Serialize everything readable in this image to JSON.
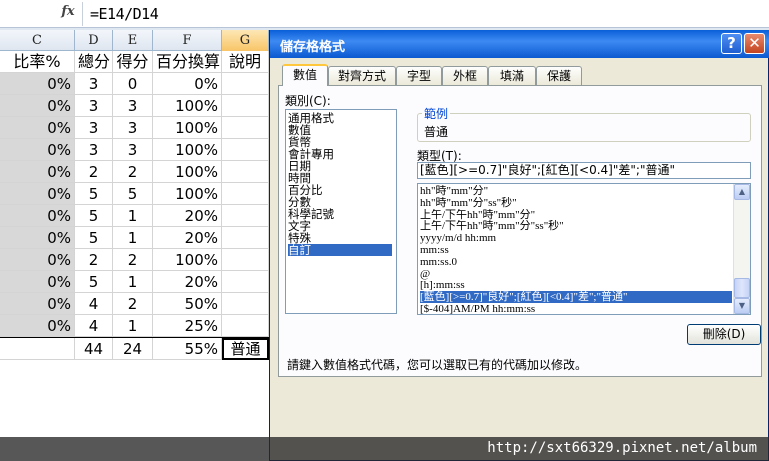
{
  "formula_bar": {
    "fx_label": "fx",
    "formula": "=E14/D14"
  },
  "sheet": {
    "columns": [
      "C",
      "D",
      "E",
      "F",
      "G"
    ],
    "selected_column": "G",
    "header_row": [
      "比率%",
      "總分",
      "得分",
      "百分換算",
      "說明"
    ],
    "rows": [
      [
        "0%",
        "3",
        "0",
        "0%"
      ],
      [
        "0%",
        "3",
        "3",
        "100%"
      ],
      [
        "0%",
        "3",
        "3",
        "100%"
      ],
      [
        "0%",
        "3",
        "3",
        "100%"
      ],
      [
        "0%",
        "2",
        "2",
        "100%"
      ],
      [
        "0%",
        "5",
        "5",
        "100%"
      ],
      [
        "0%",
        "5",
        "1",
        "20%"
      ],
      [
        "0%",
        "5",
        "1",
        "20%"
      ],
      [
        "0%",
        "2",
        "2",
        "100%"
      ],
      [
        "0%",
        "5",
        "1",
        "20%"
      ],
      [
        "0%",
        "4",
        "2",
        "50%"
      ],
      [
        "0%",
        "4",
        "1",
        "25%"
      ]
    ],
    "total_row": [
      "",
      "44",
      "24",
      "55%",
      "普通"
    ]
  },
  "dialog": {
    "title": "儲存格格式",
    "help_label": "?",
    "close_label": "✕",
    "tabs": [
      "數值",
      "對齊方式",
      "字型",
      "外框",
      "填滿",
      "保護"
    ],
    "active_tab": "數值",
    "category_label": "類別(C):",
    "categories": [
      "通用格式",
      "數值",
      "貨幣",
      "會計專用",
      "日期",
      "時間",
      "百分比",
      "分數",
      "科學記號",
      "文字",
      "特殊",
      "自訂"
    ],
    "selected_category": "自訂",
    "sample_label": "範例",
    "sample_value": "普通",
    "type_label": "類型(T):",
    "type_value": "[藍色][>=0.7]\"良好\";[紅色][<0.4]\"差\";\"普通\"",
    "type_list": [
      "hh\"時\"mm\"分\"",
      "hh\"時\"mm\"分\"ss\"秒\"",
      "上午/下午hh\"時\"mm\"分\"",
      "上午/下午hh\"時\"mm\"分\"ss\"秒\"",
      "yyyy/m/d hh:mm",
      "mm:ss",
      "mm:ss.0",
      "@",
      "[h]:mm:ss",
      "[藍色][>=0.7]\"良好\";[紅色][<0.4]\"差\";\"普通\"",
      "[$-404]AM/PM hh:mm:ss"
    ],
    "selected_type": "[藍色][>=0.7]\"良好\";[紅色][<0.4]\"差\";\"普通\"",
    "delete_label": "刪除(D)",
    "hint": "請鍵入數值格式代碼，您可以選取已有的代碼加以修改。"
  },
  "watermark": "http://sxt66329.pixnet.net/album"
}
